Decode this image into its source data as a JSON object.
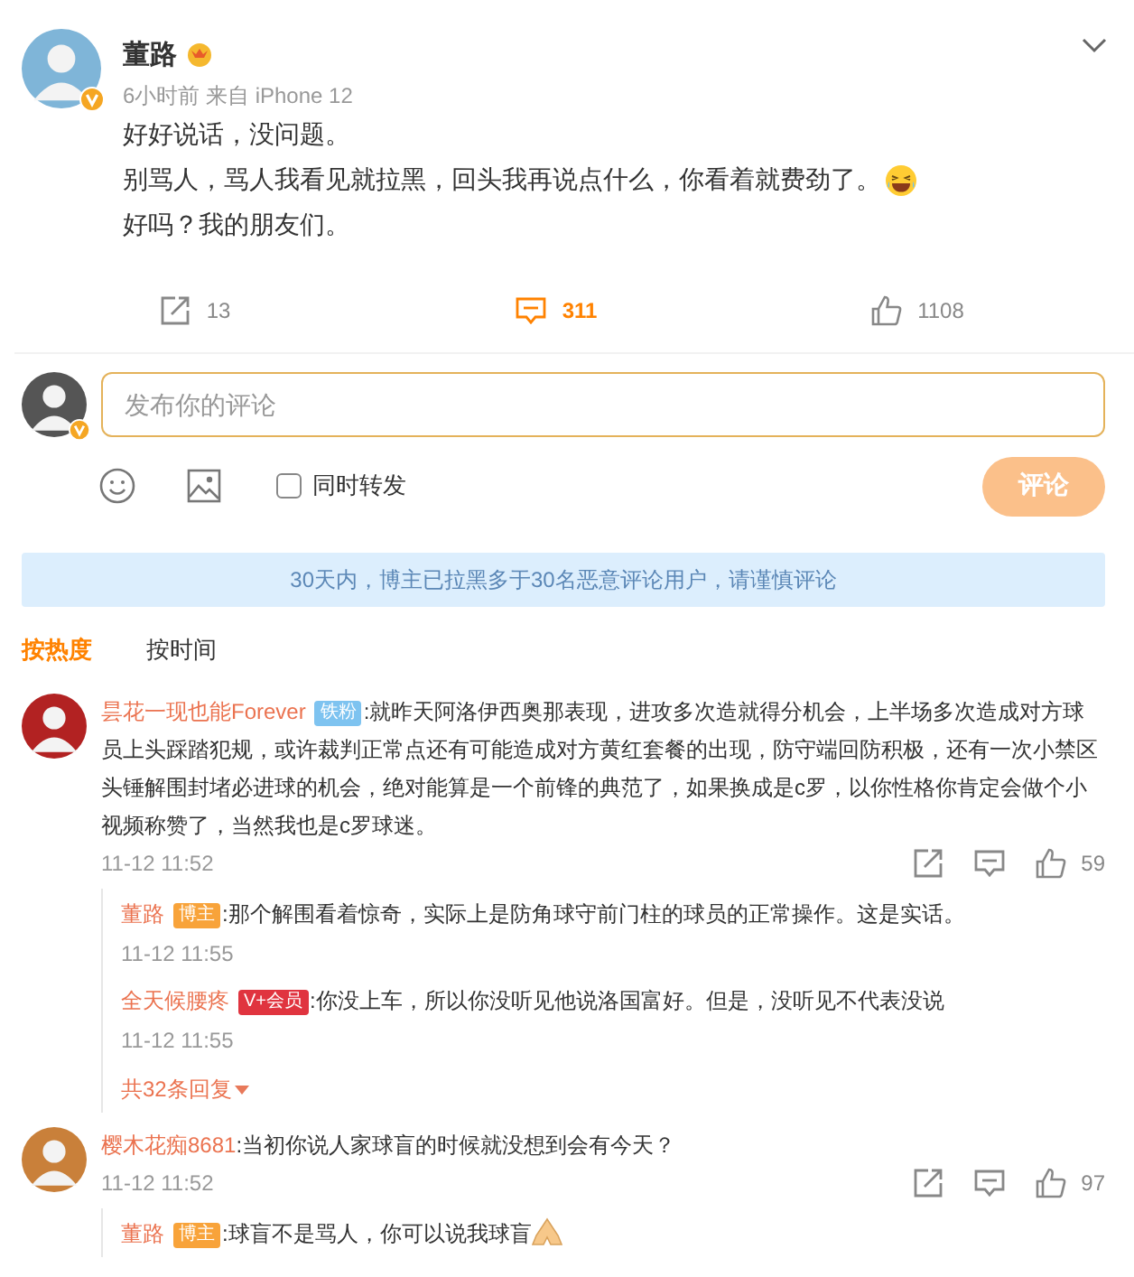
{
  "post": {
    "author": "董路",
    "meta": "6小时前 来自 iPhone 12",
    "lines": [
      {
        "text": "好好说话，没问题。"
      },
      {
        "text": "别骂人，骂人我看见就拉黑，回头我再说点什么，你看着就费劲了。",
        "emoji": true
      },
      {
        "text": "好吗？我的朋友们。"
      }
    ],
    "actions": [
      {
        "kind": "share",
        "count": "13",
        "selected": false
      },
      {
        "kind": "comment",
        "count": "311",
        "selected": true
      },
      {
        "kind": "like",
        "count": "1108",
        "selected": false
      }
    ]
  },
  "composer": {
    "placeholder": "发布你的评论",
    "repost_label": "同时转发",
    "repost_checked": false,
    "submit": "评论"
  },
  "notice": "30天内，博主已拉黑多于30名恶意评论用户，请谨慎评论",
  "sort_tabs": [
    {
      "label": "按热度",
      "selected": true
    },
    {
      "label": "按时间",
      "selected": false
    }
  ],
  "comments": [
    {
      "user": "昙花一现也能Forever",
      "badge": {
        "label": "铁粉",
        "kind": "fan"
      },
      "text": ":就昨天阿洛伊西奥那表现，进攻多次造就得分机会，上半场多次造成对方球员上头踩踏犯规，或许裁判正常点还有可能造成对方黄红套餐的出现，防守端回防积极，还有一次小禁区头锤解围封堵必进球的机会，绝对能算是一个前锋的典范了，如果换成是c罗，以你性格你肯定会做个小视频称赞了，当然我也是c罗球迷。",
      "time": "11-12 11:52",
      "likes": "59",
      "replies": [
        {
          "user": "董路",
          "badge": {
            "label": "博主",
            "kind": "author"
          },
          "text": ":那个解围看着惊奇，实际上是防角球守前门柱的球员的正常操作。这是实话。",
          "time": "11-12 11:55"
        },
        {
          "user": "全天候腰疼",
          "badge": {
            "label": "V+会员",
            "kind": "vip"
          },
          "text": ":你没上车，所以你没听见他说洛国富好。但是，没听见不代表没说",
          "time": "11-12 11:55"
        }
      ],
      "more_replies": "共32条回复"
    },
    {
      "user": "樱木花痴8681",
      "text": ":当初你说人家球盲的时候就没想到会有今天？",
      "time": "11-12 11:52",
      "likes": "97",
      "replies": [
        {
          "user": "董路",
          "badge": {
            "label": "博主",
            "kind": "author"
          },
          "text": ":球盲不是骂人，你可以说我球盲",
          "emoji": true
        }
      ]
    }
  ]
}
